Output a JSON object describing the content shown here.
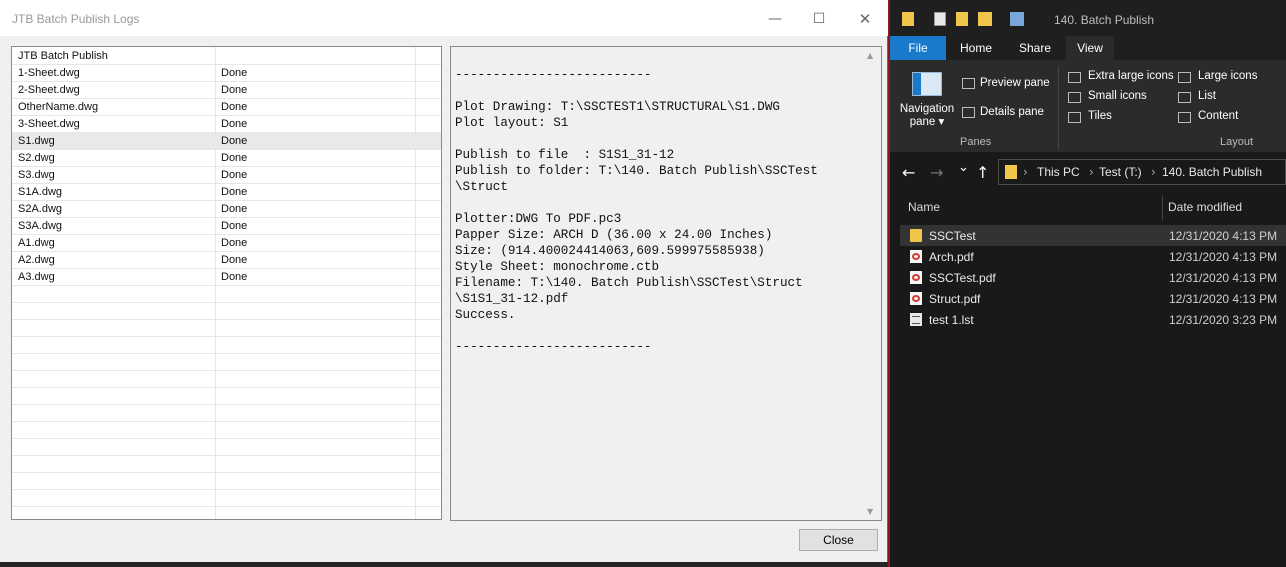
{
  "dialog": {
    "title": "JTB Batch Publish Logs",
    "minimize_glyph": "—",
    "maximize_glyph": "☐",
    "close_glyph": "✕",
    "close_button_label": "Close",
    "rows": [
      {
        "name": "JTB Batch Publish",
        "status": ""
      },
      {
        "name": "1-Sheet.dwg",
        "status": "Done"
      },
      {
        "name": "2-Sheet.dwg",
        "status": "Done"
      },
      {
        "name": "OtherName.dwg",
        "status": "Done"
      },
      {
        "name": "3-Sheet.dwg",
        "status": "Done"
      },
      {
        "name": "S1.dwg",
        "status": "Done"
      },
      {
        "name": "S2.dwg",
        "status": "Done"
      },
      {
        "name": "S3.dwg",
        "status": "Done"
      },
      {
        "name": "S1A.dwg",
        "status": "Done"
      },
      {
        "name": "S2A.dwg",
        "status": "Done"
      },
      {
        "name": "S3A.dwg",
        "status": "Done"
      },
      {
        "name": "A1.dwg",
        "status": "Done"
      },
      {
        "name": "A2.dwg",
        "status": "Done"
      },
      {
        "name": "A3.dwg",
        "status": "Done"
      }
    ],
    "log_lines": [
      "--------------------------",
      "",
      "Plot Drawing: T:\\SSCTEST1\\STRUCTURAL\\S1.DWG",
      "Plot layout: S1",
      "",
      "Publish to file  : S1S1_31-12",
      "Publish to folder: T:\\140. Batch Publish\\SSCTest",
      "\\Struct",
      "",
      "Plotter:DWG To PDF.pc3",
      "Papper Size: ARCH D (36.00 x 24.00 Inches)",
      "Size: (914.400024414063,609.599975585938)",
      "Style Sheet: monochrome.ctb",
      "Filename: T:\\140. Batch Publish\\SSCTest\\Struct",
      "\\S1S1_31-12.pdf",
      "Success.",
      "",
      "--------------------------"
    ]
  },
  "explorer": {
    "title": "140. Batch Publish",
    "tabs": {
      "file": "File",
      "home": "Home",
      "share": "Share",
      "view": "View"
    },
    "ribbon": {
      "navigation_pane": "Navigation pane ▾",
      "preview_pane": "Preview pane",
      "details_pane": "Details pane",
      "panes_group": "Panes",
      "extra_large_icons": "Extra large icons",
      "large_icons": "Large icons",
      "small_icons": "Small icons",
      "list": "List",
      "tiles": "Tiles",
      "content": "Content",
      "layout_group": "Layout"
    },
    "nav": {
      "back": "←",
      "forward": "→",
      "recent": "⌄",
      "up": "↑"
    },
    "breadcrumb": [
      "This PC",
      "Test (T:)",
      "140. Batch Publish"
    ],
    "breadcrumb_sep": "›",
    "columns": {
      "name": "Name",
      "date_modified": "Date modified"
    },
    "files": [
      {
        "name": "SSCTest",
        "date": "12/31/2020 4:13 PM",
        "type": "folder"
      },
      {
        "name": "Arch.pdf",
        "date": "12/31/2020 4:13 PM",
        "type": "pdf"
      },
      {
        "name": "SSCTest.pdf",
        "date": "12/31/2020 4:13 PM",
        "type": "pdf"
      },
      {
        "name": "Struct.pdf",
        "date": "12/31/2020 4:13 PM",
        "type": "pdf"
      },
      {
        "name": "test 1.lst",
        "date": "12/31/2020 3:23 PM",
        "type": "txt"
      }
    ]
  },
  "colors": {
    "file_tab": "#1979ca",
    "folder": "#f0c64a",
    "pdf_red": "#d03a2f",
    "cad_red_line": "#8b1a1a"
  }
}
